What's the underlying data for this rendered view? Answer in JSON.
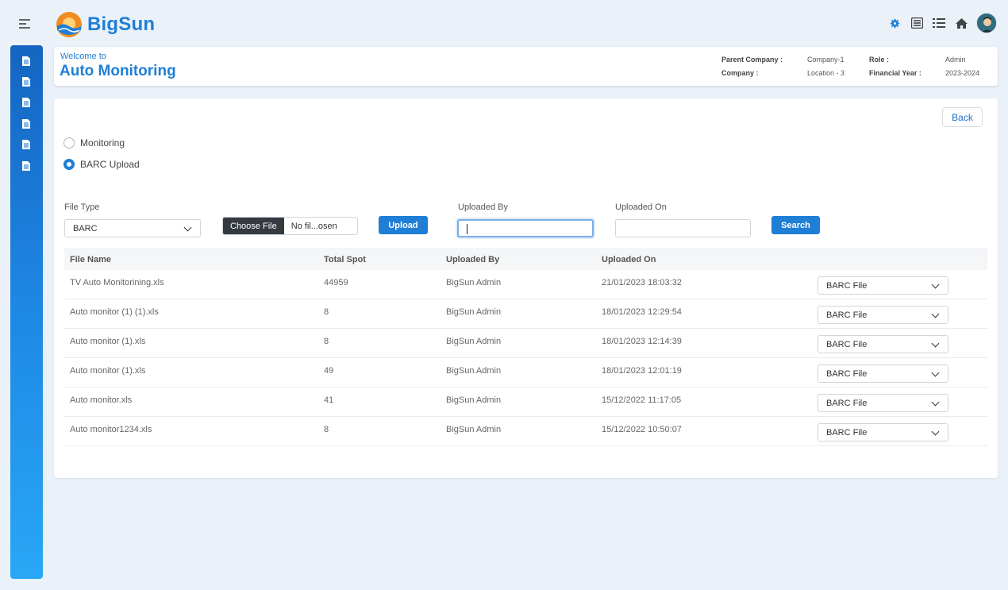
{
  "app": {
    "name": "BigSun"
  },
  "header": {
    "welcome": "Welcome to",
    "title": "Auto Monitoring",
    "parent_company_label": "Parent Company :",
    "parent_company_value": "Company-1",
    "company_label": "Company :",
    "company_value": "Location - 3",
    "role_label": "Role :",
    "role_value": "Admin",
    "fy_label": "Financial Year :",
    "fy_value": "2023-2024"
  },
  "topbar_icons": [
    "gear-icon",
    "list-box-icon",
    "list-icon",
    "home-icon",
    "avatar"
  ],
  "sidebar": {
    "items": [
      "document-icon",
      "document-icon",
      "document-icon",
      "document-icon",
      "document-icon",
      "document-icon"
    ]
  },
  "actions": {
    "back": "Back",
    "upload": "Upload",
    "search": "Search"
  },
  "radios": [
    {
      "label": "Monitoring",
      "selected": false
    },
    {
      "label": "BARC Upload",
      "selected": true
    }
  ],
  "form": {
    "file_type_label": "File Type",
    "file_type_value": "BARC",
    "choose_file": "Choose File",
    "file_name": "No fil...osen",
    "uploaded_by_label": "Uploaded By",
    "uploaded_by_value": "",
    "uploaded_on_label": "Uploaded On",
    "uploaded_on_value": ""
  },
  "table": {
    "columns": [
      "File Name",
      "Total Spot",
      "Uploaded By",
      "Uploaded On"
    ],
    "rows": [
      {
        "file": "TV Auto Monitorining.xls",
        "spot": "44959",
        "by": "BigSun Admin",
        "on": "21/01/2023 18:03:32",
        "type": "BARC File"
      },
      {
        "file": "Auto monitor (1) (1).xls",
        "spot": "8",
        "by": "BigSun Admin",
        "on": "18/01/2023 12:29:54",
        "type": "BARC File"
      },
      {
        "file": "Auto monitor (1).xls",
        "spot": "8",
        "by": "BigSun Admin",
        "on": "18/01/2023 12:14:39",
        "type": "BARC File"
      },
      {
        "file": "Auto monitor (1).xls",
        "spot": "49",
        "by": "BigSun Admin",
        "on": "18/01/2023 12:01:19",
        "type": "BARC File"
      },
      {
        "file": "Auto monitor.xls",
        "spot": "41",
        "by": "BigSun Admin",
        "on": "15/12/2022 11:17:05",
        "type": "BARC File"
      },
      {
        "file": "Auto monitor1234.xls",
        "spot": "8",
        "by": "BigSun Admin",
        "on": "15/12/2022 10:50:07",
        "type": "BARC File"
      }
    ]
  },
  "colors": {
    "accent": "#1f7fd6",
    "sidebar_top": "#1565c0",
    "sidebar_bottom": "#29a7f5",
    "page_bg": "#eaf1f9"
  }
}
